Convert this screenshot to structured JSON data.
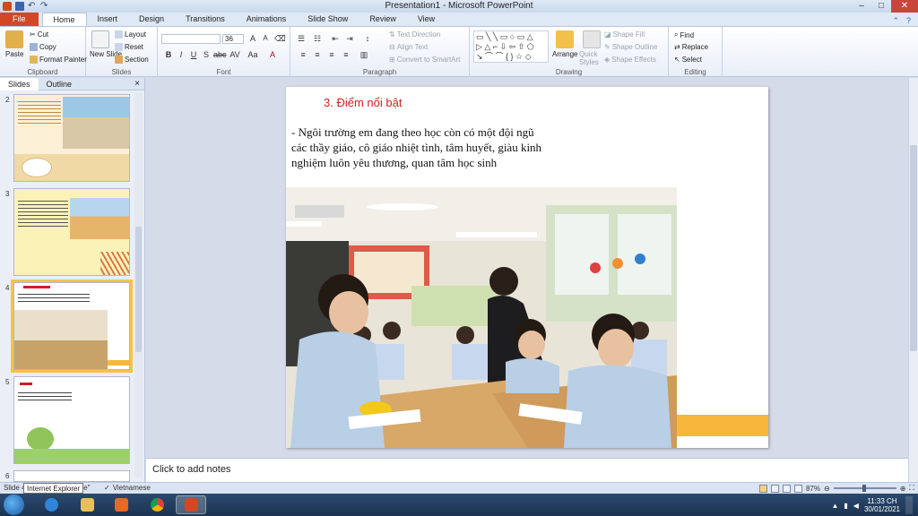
{
  "window": {
    "title": "Presentation1 - Microsoft PowerPoint"
  },
  "tabs": [
    "File",
    "Home",
    "Insert",
    "Design",
    "Transitions",
    "Animations",
    "Slide Show",
    "Review",
    "View"
  ],
  "active_tab": "Home",
  "ribbon": {
    "clipboard": {
      "label": "Clipboard",
      "paste": "Paste",
      "cut": "Cut",
      "copy": "Copy",
      "format_painter": "Format Painter"
    },
    "slides": {
      "label": "Slides",
      "new_slide": "New Slide",
      "layout": "Layout",
      "reset": "Reset",
      "section": "Section"
    },
    "font": {
      "label": "Font",
      "font_name": "",
      "font_size": "36"
    },
    "paragraph": {
      "label": "Paragraph",
      "text_direction": "Text Direction",
      "align_text": "Align Text",
      "convert_smartart": "Convert to SmartArt"
    },
    "drawing": {
      "label": "Drawing",
      "arrange": "Arrange",
      "quick_styles": "Quick Styles",
      "shape_fill": "Shape Fill",
      "shape_outline": "Shape Outline",
      "shape_effects": "Shape Effects"
    },
    "editing": {
      "label": "Editing",
      "find": "Find",
      "replace": "Replace",
      "select": "Select"
    }
  },
  "pane": {
    "tab_slides": "Slides",
    "tab_outline": "Outline",
    "close": "×"
  },
  "thumbnails": [
    {
      "num": "2"
    },
    {
      "num": "3"
    },
    {
      "num": "4"
    },
    {
      "num": "5"
    },
    {
      "num": "6"
    }
  ],
  "slide": {
    "title": "3. Điểm nổi bật",
    "body_line1": " - Ngôi trường em đang theo học còn có một đội ngũ",
    "body_line2": "các thầy giáo, cô giáo nhiệt tình, tâm huyết, giàu kinh",
    "body_line3": "nghiệm luôn yêu thương, quan tâm học sinh"
  },
  "notes": {
    "placeholder": "Click to add notes"
  },
  "status": {
    "slide_info_prefix": "Slide 4",
    "theme_suffix": "me\"",
    "tooltip": "Internet Explorer",
    "language": "Vietnamese",
    "zoom": "87%"
  },
  "taskbar": {
    "time": "11:33 CH",
    "date": "30/01/2021"
  },
  "colors": {
    "accent": "#d24726",
    "title_red": "#d21e1e",
    "selection": "#f5c34a",
    "yellow_bar": "#f6b73c"
  }
}
